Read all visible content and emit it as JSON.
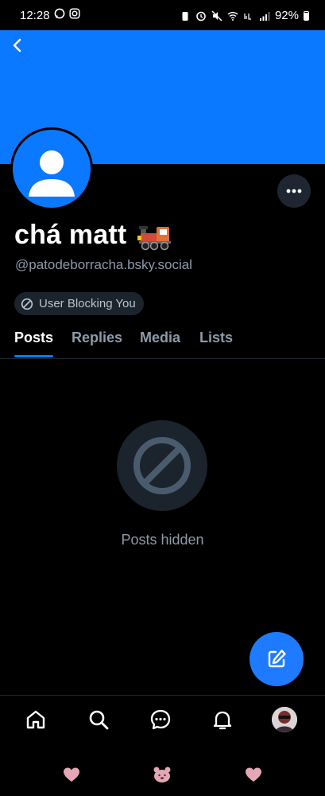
{
  "status_bar": {
    "time": "12:28",
    "left_icons": [
      "whatsapp-icon",
      "instagram-icon"
    ],
    "right_icons": [
      "battery-saver-icon",
      "alarm-icon",
      "mute-icon",
      "wifi-icon",
      "volte-icon",
      "signal-icon"
    ],
    "battery": "92%"
  },
  "profile": {
    "display_name": "chá matt",
    "handle": "@patodeborracha.bsky.social",
    "blocking_label": "User Blocking You"
  },
  "tabs": [
    {
      "label": "Posts",
      "active": true
    },
    {
      "label": "Replies",
      "active": false
    },
    {
      "label": "Media",
      "active": false
    },
    {
      "label": "Lists",
      "active": false
    }
  ],
  "empty_state": {
    "text": "Posts hidden"
  },
  "colors": {
    "accent": "#0b79ff",
    "background": "#000000",
    "muted_text": "#8d9aa8"
  },
  "bottom_nav": [
    "home-icon",
    "search-icon",
    "chat-icon",
    "bell-icon",
    "profile-avatar"
  ]
}
